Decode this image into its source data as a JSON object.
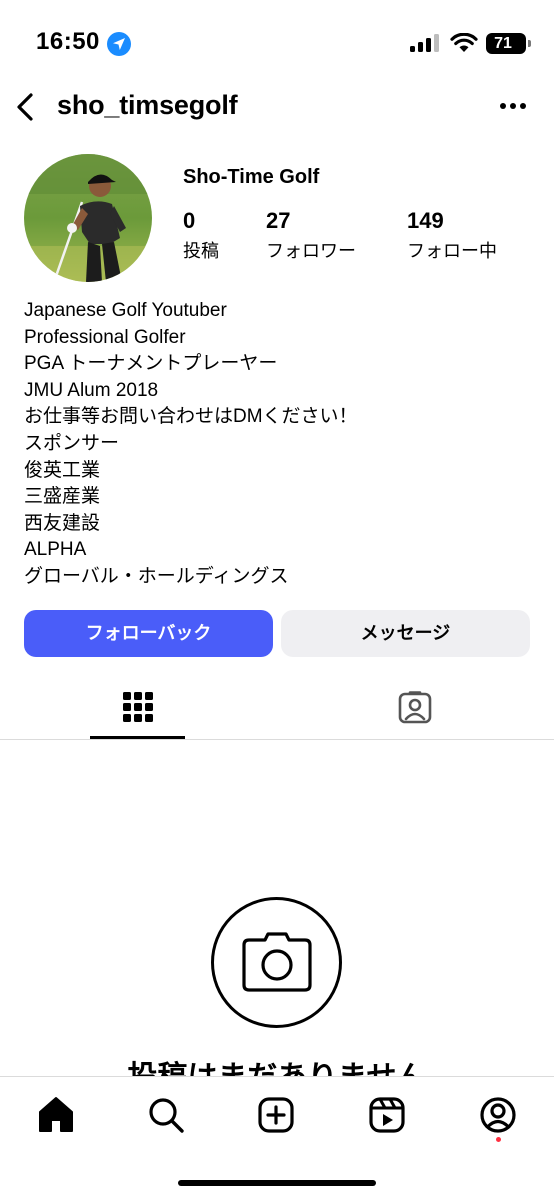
{
  "status_bar": {
    "time": "16:50",
    "battery": "71",
    "icons": [
      "location-arrow-icon",
      "cellular-signal-icon",
      "wifi-icon",
      "battery-icon"
    ]
  },
  "header": {
    "username": "sho_timsegolf",
    "icons": [
      "back-chevron-icon",
      "more-options-icon"
    ]
  },
  "profile": {
    "display_name": "Sho-Time Golf",
    "stats": [
      {
        "value": "0",
        "label": "投稿"
      },
      {
        "value": "27",
        "label": "フォロワー"
      },
      {
        "value": "149",
        "label": "フォロー中"
      }
    ],
    "bio": [
      "Japanese Golf Youtuber",
      "Professional Golfer",
      "PGA トーナメントプレーヤー",
      "JMU Alum 2018",
      "お仕事等お問い合わせはDMください！",
      "スポンサー",
      "俊英工業",
      "三盛産業",
      "西友建設",
      "ALPHA",
      "グローバル・ホールディングス"
    ]
  },
  "actions": {
    "follow_back": "フォローバック",
    "message": "メッセージ"
  },
  "tabs": {
    "items": [
      "grid-icon",
      "tagged-icon"
    ],
    "active": 0
  },
  "empty_state": {
    "title": "投稿はまだありません"
  },
  "bottom_nav": {
    "items": [
      "home-icon",
      "search-icon",
      "create-icon",
      "reels-icon",
      "profile-icon"
    ],
    "active": 0
  },
  "colors": {
    "accent": "#4a5df9",
    "secondary_button": "#efeff2",
    "location": "#1a8cff",
    "notification": "#ff2f40"
  }
}
